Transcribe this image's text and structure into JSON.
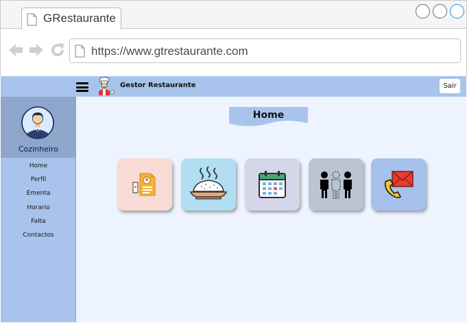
{
  "browser": {
    "tab_title": "GRestaurante",
    "url": "https://www.gtrestaurante.com"
  },
  "header": {
    "brand": "Gestor Restaurante",
    "logout_label": "Sair"
  },
  "sidebar": {
    "role": "Cozinheiro",
    "items": [
      {
        "label": "Home"
      },
      {
        "label": "Perfil"
      },
      {
        "label": "Ementa"
      },
      {
        "label": "Horario"
      },
      {
        "label": "Falta"
      },
      {
        "label": "Contactos"
      }
    ]
  },
  "main": {
    "title": "Home",
    "tiles": [
      {
        "icon": "profile-document-icon",
        "color": "#fadad4"
      },
      {
        "icon": "rice-dish-icon",
        "color": "#b1def3"
      },
      {
        "icon": "calendar-icon",
        "color": "#d6d6ea"
      },
      {
        "icon": "absence-people-icon",
        "color": "#b9c5d1"
      },
      {
        "icon": "phone-mail-icon",
        "color": "#a5c1ec"
      }
    ]
  },
  "colors": {
    "topbar": "#a9c4ec",
    "sidebar": "#a9c4ec",
    "profile_panel": "#8fa6cc",
    "content_bg": "#eef4ff"
  }
}
